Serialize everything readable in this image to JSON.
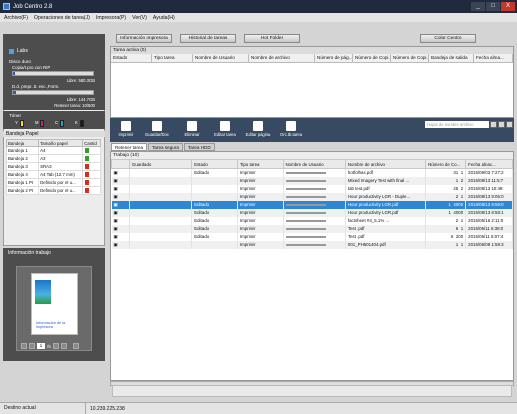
{
  "window": {
    "title": "Job Centro 2.8",
    "min": "_",
    "max": "□",
    "close": "X"
  },
  "menu": [
    "Archivo(F)",
    "Operaciones de tarea(J)",
    "Impresora(P)",
    "Ver(V)",
    "Ayuda(H)"
  ],
  "device": {
    "name": "Labs",
    "disk_label": "Disco duro",
    "disk1_label": "Copia/I.pro.con RIP",
    "disk1_free": "Libre: 580.3GB",
    "disk1_fraction": 0.03,
    "disk2_label": "D.d. prepr..tt. esc.,Form.",
    "disk2_free": "Libre: 144.7GB",
    "disk2_fraction": 0.04,
    "retain": "Retener tarea: 10/500"
  },
  "toner": {
    "label": "Tóner",
    "colors": [
      {
        "name": "Y",
        "hex": "#f2e020"
      },
      {
        "name": "M",
        "hex": "#d81a8c"
      },
      {
        "name": "C",
        "hex": "#12a4dc"
      },
      {
        "name": "K",
        "hex": "#1a1a1a"
      }
    ]
  },
  "trays": {
    "label": "Bandeja Papel",
    "headers": [
      "Bandeja",
      "Tamaño papel",
      "Cantid"
    ],
    "rows": [
      {
        "tray": "Bandeja 1",
        "size": "A4",
        "color": "#3c9a2c"
      },
      {
        "tray": "Bandeja 2",
        "size": "A3",
        "color": "#3c9a2c"
      },
      {
        "tray": "Bandeja 3",
        "size": "SRA3",
        "color": "#d03020"
      },
      {
        "tray": "Bandeja 4",
        "size": "A4 Tab (12.7 mm)",
        "color": "#d03020"
      },
      {
        "tray": "Bandeja 1 PI",
        "size": "Definido por el u...",
        "color": "#d03020"
      },
      {
        "tray": "Bandeja 2 PI",
        "size": "Definido por el u...",
        "color": "#d03020"
      }
    ]
  },
  "info": {
    "title": "Información trabajo",
    "page_current": "1",
    "page_total": "/5",
    "preview_text": "Información de la impresora"
  },
  "topbuttons": [
    "Información impresora",
    "Historial de tareas",
    "Hot Folder",
    "Color Centro"
  ],
  "active": {
    "title": "Tarea activa (0)",
    "headers": [
      "Estado",
      "Tipo tarea",
      "Nombre de Usuario",
      "Nombre de archivo",
      "Número de pág...",
      "Número de Copi...",
      "Número de Copi...",
      "Bandeja de salida",
      "Fecha alma..."
    ]
  },
  "toolbar": [
    "Imprimir",
    "Guardar/Doc",
    "Eliminar",
    "Editar tarea",
    "Editar página",
    "Orc.tb.tarea"
  ],
  "search_placeholder": "Hojas de nombre archivo",
  "tabs": [
    "Retener tarea",
    "Tarea segura",
    "Tarea HDD"
  ],
  "jobs": {
    "title": "Trabajo (10)",
    "headers": [
      "",
      "Guardado",
      "Estado",
      "Tipo tarea",
      "Nombre de Usuario",
      "Nombre de archivo",
      "Número de Co...",
      "Fecha alnac..."
    ],
    "rows": [
      {
        "guard": "",
        "state": "Editado",
        "type": "Imprimir",
        "file": "hotfolhas.pdf",
        "pages": "31",
        "copies": "1",
        "date": "2015/09/03 7:27:2"
      },
      {
        "guard": "",
        "state": "",
        "type": "Imprimir",
        "file": "Mixed Imagery Test with final ...",
        "pages": "1",
        "copies": "2",
        "date": "2015/08/13 11:5:7"
      },
      {
        "guard": "",
        "state": "",
        "type": "Imprimir",
        "file": "tab test.pdf",
        "pages": "25",
        "copies": "2",
        "date": "2015/08/13 10:49:"
      },
      {
        "guard": "",
        "state": "",
        "type": "Imprimir",
        "file": "Hour productivity LGR - Duple...",
        "pages": "2",
        "copies": "1",
        "date": "2015/08/13 9:05:0"
      },
      {
        "guard": "",
        "state": "Editado",
        "type": "Imprimir",
        "file": "Hour productivity LGR.pdf",
        "pages": "1",
        "copies": "4000",
        "date": "2015/08/13 8:59:0"
      },
      {
        "guard": "",
        "state": "Editado",
        "type": "Imprimir",
        "file": "Hour productivity LGR.pdf",
        "pages": "1",
        "copies": "4000",
        "date": "2015/08/13 8:58:1"
      },
      {
        "guard": "",
        "state": "Editado",
        "type": "Imprimir",
        "file": "factsheet #4_5.1% ...",
        "pages": "2",
        "copies": "1",
        "date": "2015/06/16 2:11:0"
      },
      {
        "guard": "",
        "state": "Editado",
        "type": "Imprimir",
        "file": "Test .pdf",
        "pages": "6",
        "copies": "1",
        "date": "2015/06/11 6:38:0"
      },
      {
        "guard": "",
        "state": "Editado",
        "type": "Imprimir",
        "file": "Test .pdf",
        "pages": "6",
        "copies": "200",
        "date": "2015/06/11 5:07:4"
      },
      {
        "guard": "",
        "state": "",
        "type": "Imprimir",
        "file": "001_PH501404.pdf",
        "pages": "1",
        "copies": "1",
        "date": "2015/06/09 1:58:3"
      }
    ]
  },
  "status": {
    "left": "Destino actual",
    "ip": "10.239.225.238"
  }
}
